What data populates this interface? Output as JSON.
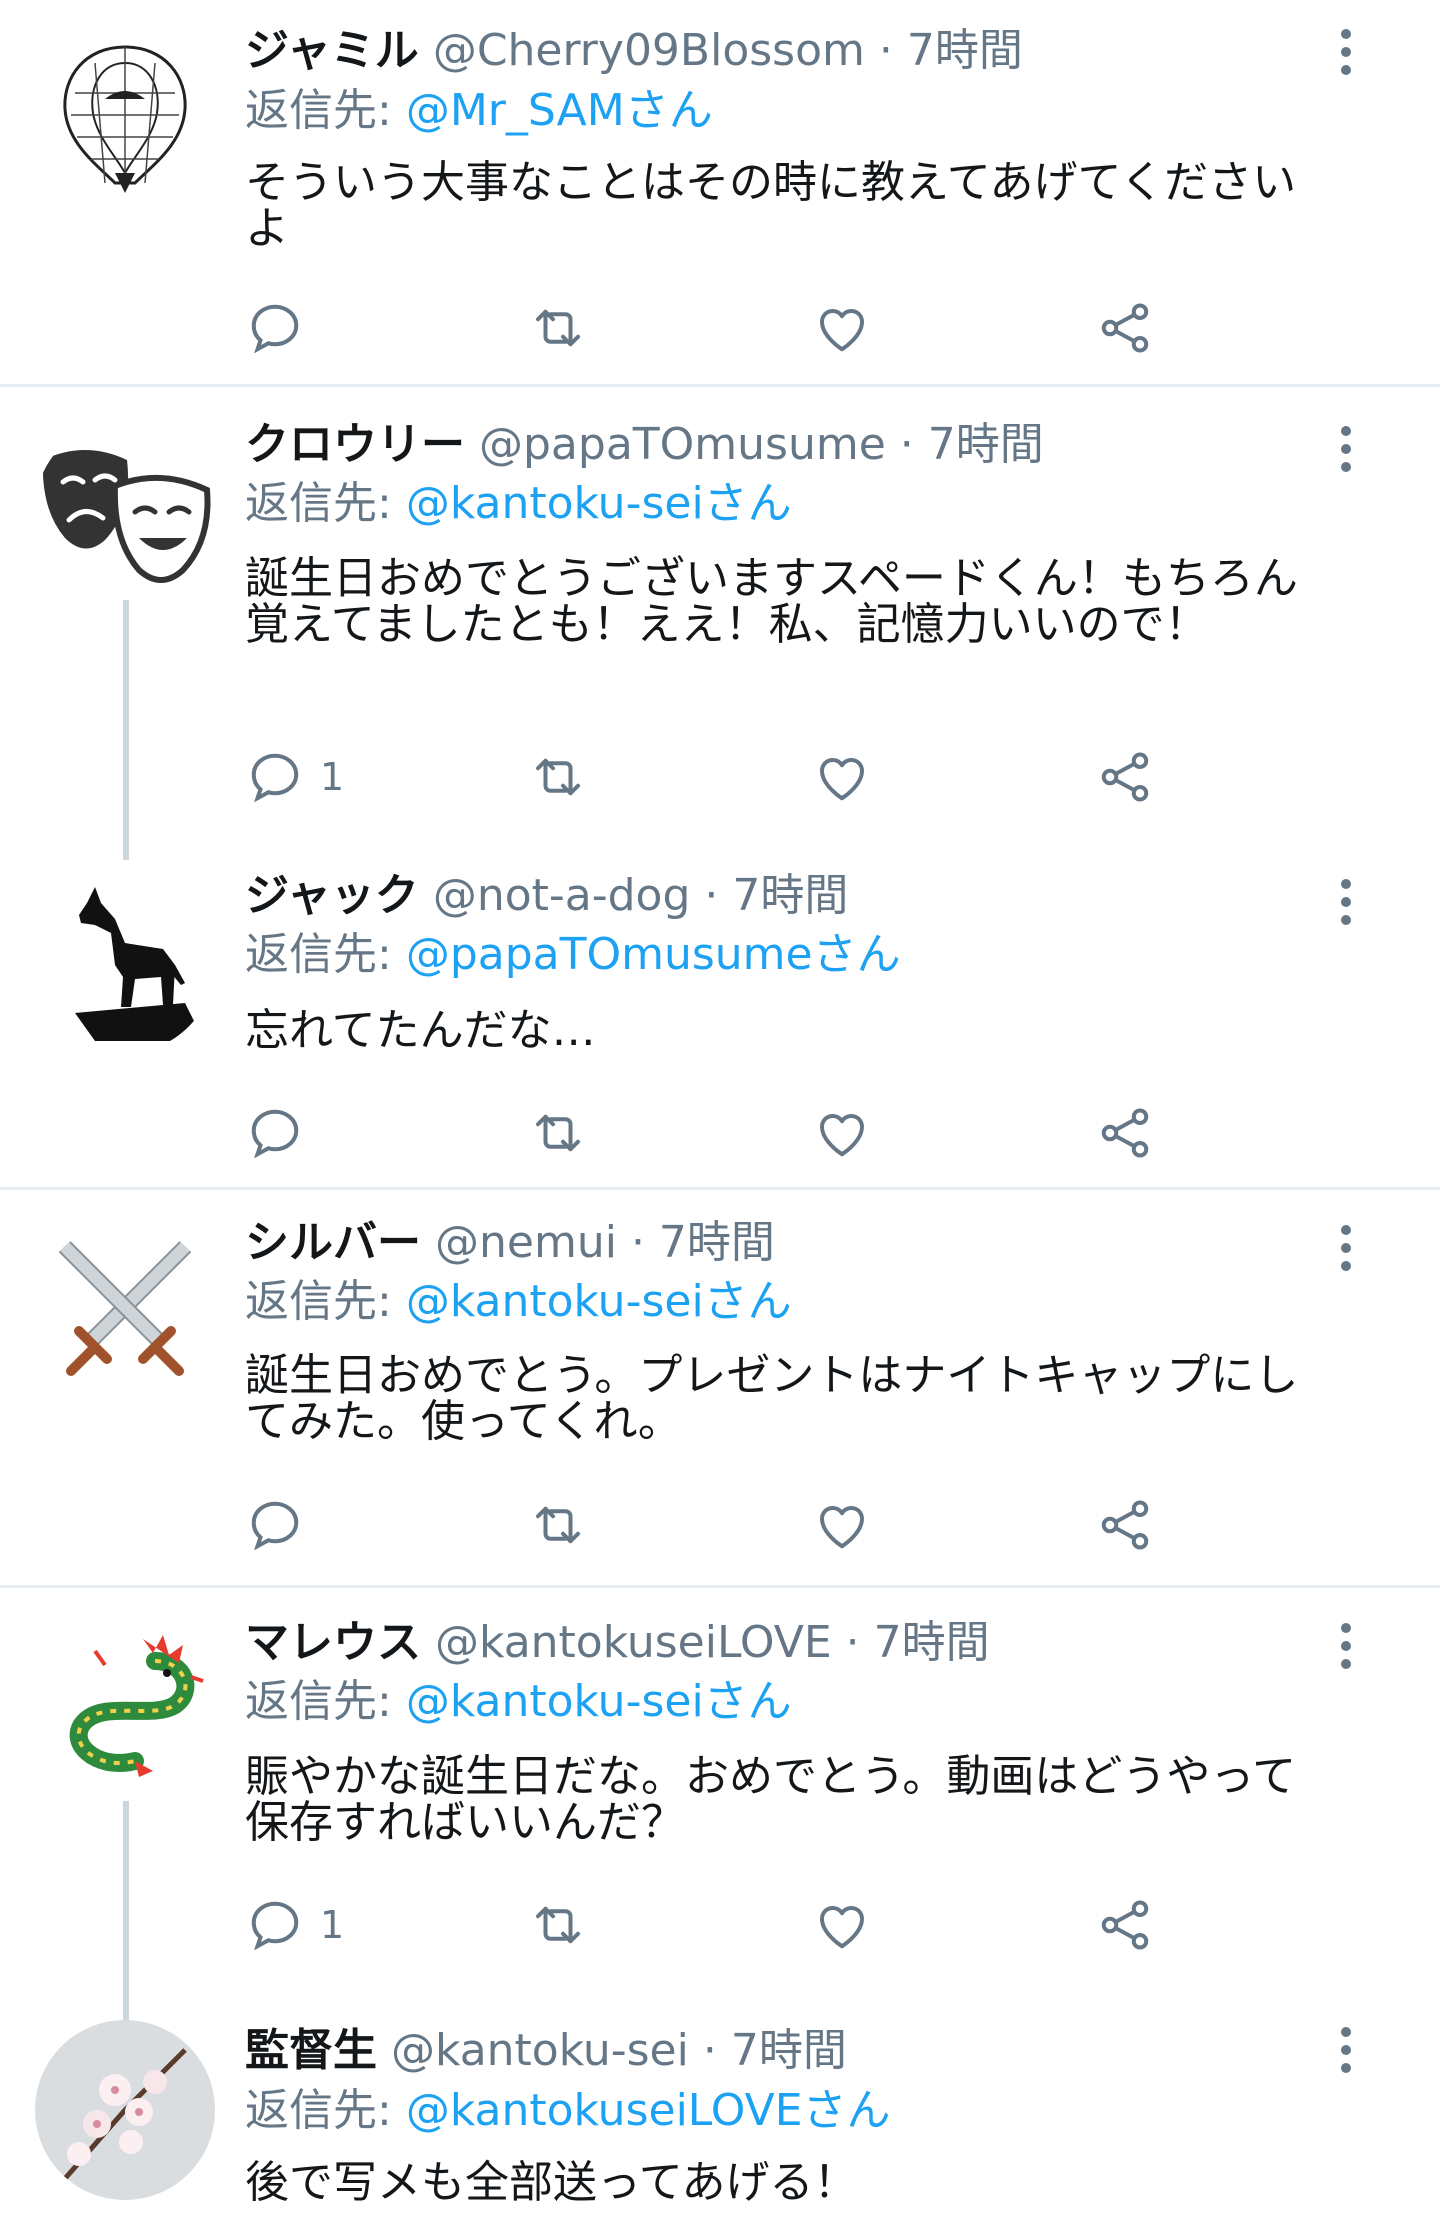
{
  "tweets": [
    {
      "name": "ジャミル",
      "handle": "@Cherry09Blossom",
      "time": "7時間",
      "reply_label": "返信先:",
      "reply_to": "@Mr_SAMさん",
      "text": "そういう大事なことはその時に教えてあげてください よ",
      "reply_count": "",
      "avatar": "snake-avatar"
    },
    {
      "name": "クロウリー",
      "handle": "@papaTOmusume",
      "time": "7時間",
      "reply_label": "返信先:",
      "reply_to": "@kantoku-seiさん",
      "text": "誕生日おめでとうございますスペードくん！もちろん覚えてましたとも！ええ！私、記憶力いいので！",
      "reply_count": "1",
      "avatar": "theater-masks-avatar"
    },
    {
      "name": "ジャック",
      "handle": "@not-a-dog",
      "time": "7時間",
      "reply_label": "返信先:",
      "reply_to": "@papaTOmusumeさん",
      "text": "忘れてたんだな…",
      "reply_count": "",
      "avatar": "wolf-avatar"
    },
    {
      "name": "シルバー",
      "handle": "@nemui",
      "time": "7時間",
      "reply_label": "返信先:",
      "reply_to": "@kantoku-seiさん",
      "text": "誕生日おめでとう。プレゼントはナイトキャップにしてみた。使ってくれ。",
      "reply_count": "",
      "avatar": "crossed-swords-avatar"
    },
    {
      "name": "マレウス",
      "handle": "@kantokuseiLOVE",
      "time": "7時間",
      "reply_label": "返信先:",
      "reply_to": "@kantoku-seiさん",
      "text": "賑やかな誕生日だな。おめでとう。動画はどうやって保存すればいいんだ？",
      "reply_count": "1",
      "avatar": "dragon-avatar"
    },
    {
      "name": "監督生",
      "handle": "@kantoku-sei",
      "time": "7時間",
      "reply_label": "返信先:",
      "reply_to": "@kantokuseiLOVEさん",
      "text": "後で写メも全部送ってあげる！",
      "reply_count": "",
      "avatar": "cherry-blossom-avatar"
    }
  ],
  "colors": {
    "link": "#1da1f2",
    "muted": "#657786",
    "separator": "#e6ecf0",
    "thread_line": "#ccd6dd"
  }
}
